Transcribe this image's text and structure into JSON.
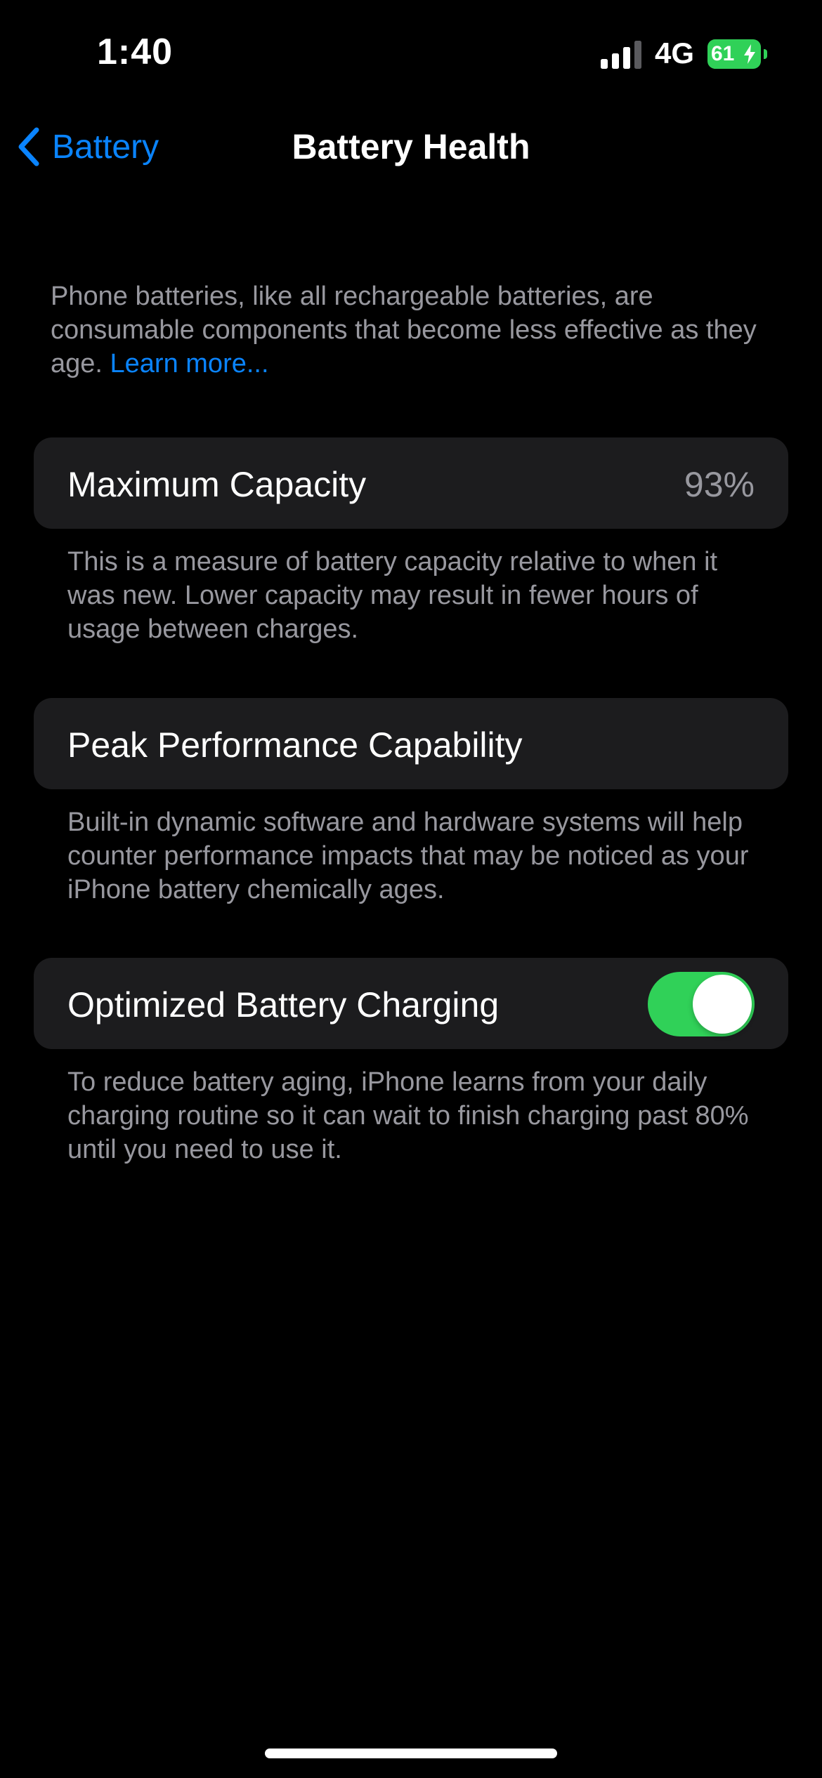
{
  "status_bar": {
    "time": "1:40",
    "network": "4G",
    "battery_level": "61",
    "battery_color": "#30d158"
  },
  "nav": {
    "back_label": "Battery",
    "title": "Battery Health"
  },
  "intro": {
    "text": "Phone batteries, like all rechargeable batteries, are consumable components that become less effective as they age. ",
    "link_label": "Learn more..."
  },
  "max_capacity": {
    "label": "Maximum Capacity",
    "value": "93%",
    "footer": "This is a measure of battery capacity relative to when it was new. Lower capacity may result in fewer hours of usage between charges."
  },
  "peak_performance": {
    "label": "Peak Performance Capability",
    "footer": "Built-in dynamic software and hardware systems will help counter performance impacts that may be noticed as your iPhone battery chemically ages."
  },
  "optimized_charging": {
    "label": "Optimized Battery Charging",
    "enabled": true,
    "footer": "To reduce battery aging, iPhone learns from your daily charging routine so it can wait to finish charging past 80% until you need to use it."
  },
  "colors": {
    "accent": "#0a84ff",
    "toggle_on": "#30d158",
    "cell_background": "#1c1c1e",
    "secondary_text": "#98989f"
  },
  "icons": {
    "back": "chevron-left-icon",
    "signal": "cellular-signal-icon",
    "battery": "battery-icon",
    "charging": "lightning-bolt-icon"
  }
}
